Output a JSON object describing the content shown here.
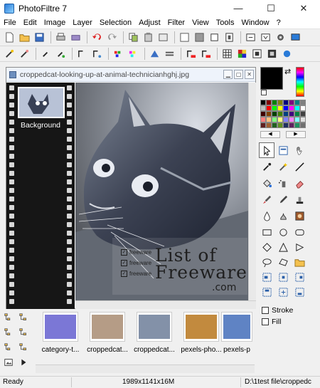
{
  "app": {
    "title": "PhotoFiltre 7"
  },
  "window_controls": {
    "minimize": "—",
    "maximize": "☐",
    "close": "✕"
  },
  "menu": [
    "File",
    "Edit",
    "Image",
    "Layer",
    "Selection",
    "Adjust",
    "Filter",
    "View",
    "Tools",
    "Window",
    "?"
  ],
  "document": {
    "title": "croppedcat-looking-up-at-animal-technicianhghj.jpg",
    "layer_label": "Background",
    "watermark": {
      "line1": "List of",
      "line2": "Freeware",
      "line3": ".com",
      "checks": [
        "freeware",
        "freeware",
        "freeware"
      ]
    }
  },
  "right_panel": {
    "stroke_label": "Stroke",
    "fill_label": "Fill"
  },
  "bottom_files": [
    {
      "label": "category-t...",
      "thumb_color": "#7b77d6"
    },
    {
      "label": "croppedcat...",
      "thumb_color": "#b59c86"
    },
    {
      "label": "croppedcat...",
      "thumb_color": "#8391a8"
    },
    {
      "label": "pexels-pho...",
      "thumb_color": "#c28a3e"
    },
    {
      "label": "pexels-p",
      "thumb_color": "#5f83c4"
    }
  ],
  "status": {
    "ready": "Ready",
    "dimensions": "1989x1141x16M",
    "path": "D:\\1test file\\croppedc"
  },
  "colors": {
    "accent": "#2a7bd8",
    "filmstrip": "#161616"
  }
}
